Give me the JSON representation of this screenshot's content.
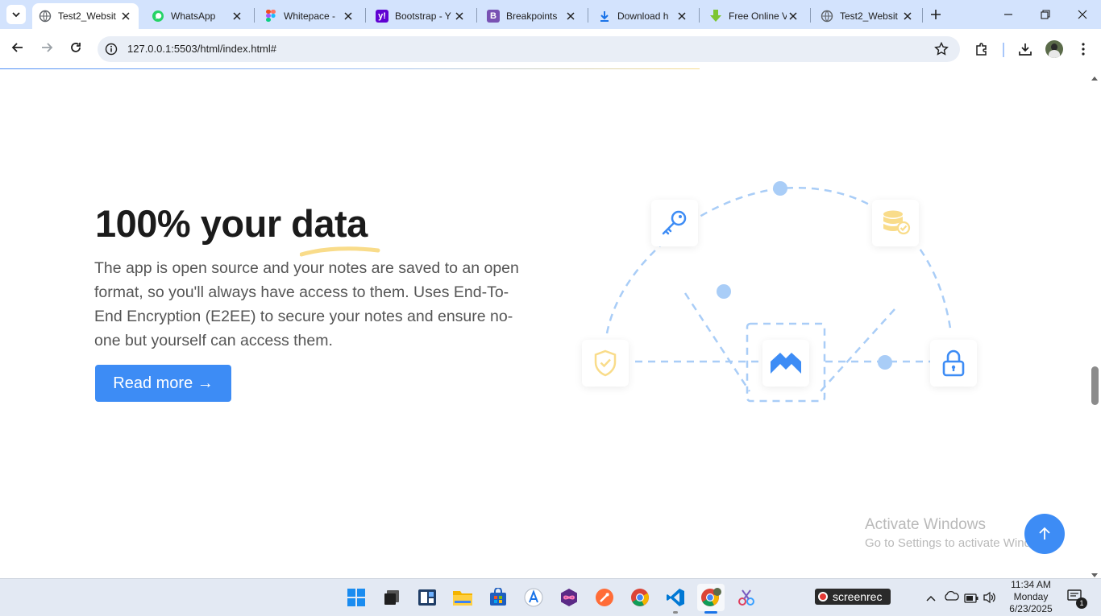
{
  "browser": {
    "tabs": [
      {
        "title": "Test2_Websit",
        "favicon": "globe-icon",
        "active": true
      },
      {
        "title": "WhatsApp",
        "favicon": "whatsapp-icon",
        "active": false
      },
      {
        "title": "Whitepace -",
        "favicon": "figma-icon",
        "active": false
      },
      {
        "title": "Bootstrap - Y",
        "favicon": "yahoo-icon",
        "active": false
      },
      {
        "title": "Breakpoints",
        "favicon": "bootstrap-icon",
        "active": false
      },
      {
        "title": "Download h",
        "favicon": "download-icon",
        "active": false
      },
      {
        "title": "Free Online V",
        "favicon": "download-green-icon",
        "active": false
      },
      {
        "title": "Test2_Websit",
        "favicon": "globe-icon",
        "active": false
      }
    ],
    "url": "127.0.0.1:5503/html/index.html#"
  },
  "section": {
    "heading": "100% your data",
    "paragraph": "The app is open source and your notes are saved to an open format, so you'll always have access to them. Uses End-To-End Encryption (E2EE) to secure your notes and ensure no-one but yourself can access them.",
    "button_label": "Read more →"
  },
  "diagram": {
    "nodes": [
      "key-icon",
      "database-check-icon",
      "shield-check-icon",
      "whitepace-logo-icon",
      "lock-icon"
    ],
    "accent": "#3d8cf5",
    "dash_color": "#a9cdf7",
    "yellow": "#f9dc8a"
  },
  "watermark": {
    "line1": "Activate Windows",
    "line2": "Go to Settings to activate Windows."
  },
  "taskbar": {
    "screenrec_label": "screenrec",
    "time": "11:34 AM",
    "day": "Monday",
    "date": "6/23/2025",
    "notification_count": "1"
  }
}
